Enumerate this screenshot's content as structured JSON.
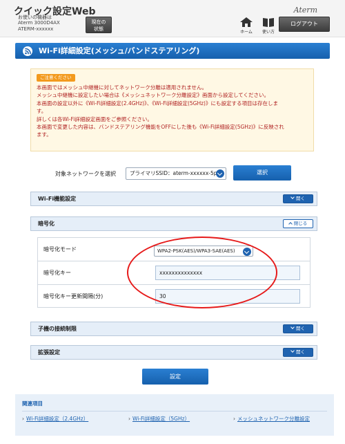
{
  "header": {
    "app_title": "クイック設定Web",
    "device_label": "お使いの機器は",
    "device_model": "Aterm 3000D4AX",
    "device_id": "ATERM-xxxxxx",
    "status_button": "現在の\n状態",
    "brand": "Aterm",
    "home_label": "ホーム",
    "help_label": "使い方",
    "logout_label": "ログアウト"
  },
  "page": {
    "title": "Wi-Fi詳細設定(メッシュ/バンドステアリング)"
  },
  "notice": {
    "badge": "ご注意ください",
    "lines": [
      "本画面ではメッシュ中継機に対してネットワーク分離は適用されません。",
      "メッシュ中継機に設定したい場合は《メッシュネットワーク分離設定》画面から設定してください。",
      "本画面の設定以外に《Wi-Fi詳細設定(2.4GHz)》、《Wi-Fi詳細設定(5GHz)》にも設定する項目は存在しま",
      "す。",
      "詳しくは各Wi-Fi詳細設定画面をご参照ください。",
      "本画面で変更した内容は、バンドステアリング機能をOFFにした後も《Wi-Fi詳細設定(5GHz)》に反映され",
      "ます。"
    ]
  },
  "network_select": {
    "label": "対象ネットワークを選択",
    "value": "プライマリSSID：aterm-xxxxxx-5p",
    "button": "選択"
  },
  "sections": {
    "wifi_function": {
      "label": "Wi-Fi機能設定",
      "toggle": "開く"
    },
    "encryption": {
      "label": "暗号化",
      "toggle": "閉じる"
    },
    "connection_limit": {
      "label": "子機の接続制限",
      "toggle": "開く"
    },
    "extended": {
      "label": "拡張設定",
      "toggle": "開く"
    }
  },
  "encryption_fields": {
    "mode_label": "暗号化モード",
    "mode_value": "WPA2-PSK(AES)/WPA3-SAE(AES)",
    "key_label": "暗号化キー",
    "key_value": "xxxxxxxxxxxxxx",
    "interval_label": "暗号化キー更新間隔(分)",
    "interval_value": "30"
  },
  "submit_label": "設定",
  "related": {
    "title": "関連項目",
    "links": [
      "Wi-Fi詳細設定（2.4GHz）",
      "Wi-Fi詳細設定（5GHz）",
      "メッシュネットワーク分離設定"
    ]
  },
  "colors": {
    "primary": "#1f63b0",
    "notice_text": "#b02222",
    "highlight": "#e61a1a"
  }
}
